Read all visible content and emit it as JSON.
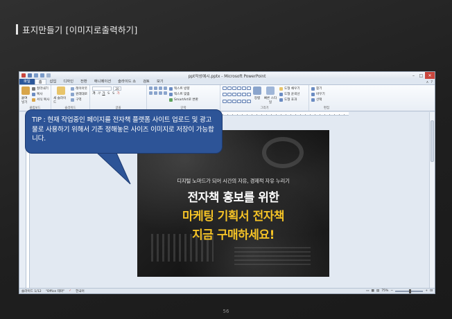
{
  "page": {
    "title": "표지만들기 [이미지로출력하기]",
    "page_number": "56"
  },
  "window": {
    "title": "ppt작성예시.pptx - Microsoft PowerPoint",
    "controls": [
      "–",
      "□",
      "✕"
    ]
  },
  "ribbon_tabs": [
    "파일",
    "홈",
    "삽입",
    "디자인",
    "전환",
    "애니메이션",
    "슬라이드 쇼",
    "검토",
    "보기"
  ],
  "ribbon": {
    "clipboard": {
      "paste": "붙여넣기",
      "cut": "잘라내기",
      "copy": "복사",
      "format": "서식 복사",
      "label": "클립보드"
    },
    "slides": {
      "layout": "레이아웃",
      "reset": "원래대로",
      "section": "구역",
      "new_slide": "새 슬라이드",
      "label": "슬라이드"
    },
    "font": {
      "size": "20",
      "label": "글꼴"
    },
    "paragraph": {
      "text_dir": "텍스트 방향",
      "align_text": "텍스트 맞춤",
      "smartart": "SmartArt로 변환",
      "label": "단락"
    },
    "drawing": {
      "arrange": "정렬",
      "quick_styles": "빠른 스타일",
      "fill": "도형 채우기",
      "outline": "도형 윤곽선",
      "effects": "도형 효과",
      "label": "그리기"
    },
    "editing": {
      "find": "찾기",
      "replace": "바꾸기",
      "select": "선택",
      "label": "편집"
    }
  },
  "slide": {
    "subtitle": "디지털 노마드가 되어 시간의 자유, 경제적 자유 누리기",
    "line1": "전자책 홍보를 위한",
    "line2": "마케팅 기획서 전자책",
    "line3": "지금 구매하세요!",
    "colors": {
      "white": "#ffffff",
      "yellow": "#f5c326"
    }
  },
  "status": {
    "slide_info": "슬라이드 1/12",
    "theme": "\"Office 테마\"",
    "language": "한국어",
    "zoom": "75%"
  },
  "callout": {
    "text": "TIP : 현재 작업중인 페이지를 전자책 플랫폼 사이트 업로드 및 광고물로 사용하기 위해서 기존 정해놓은 사이즈 이미지로 저장이 가능합니다.",
    "color": "#2d5497"
  }
}
